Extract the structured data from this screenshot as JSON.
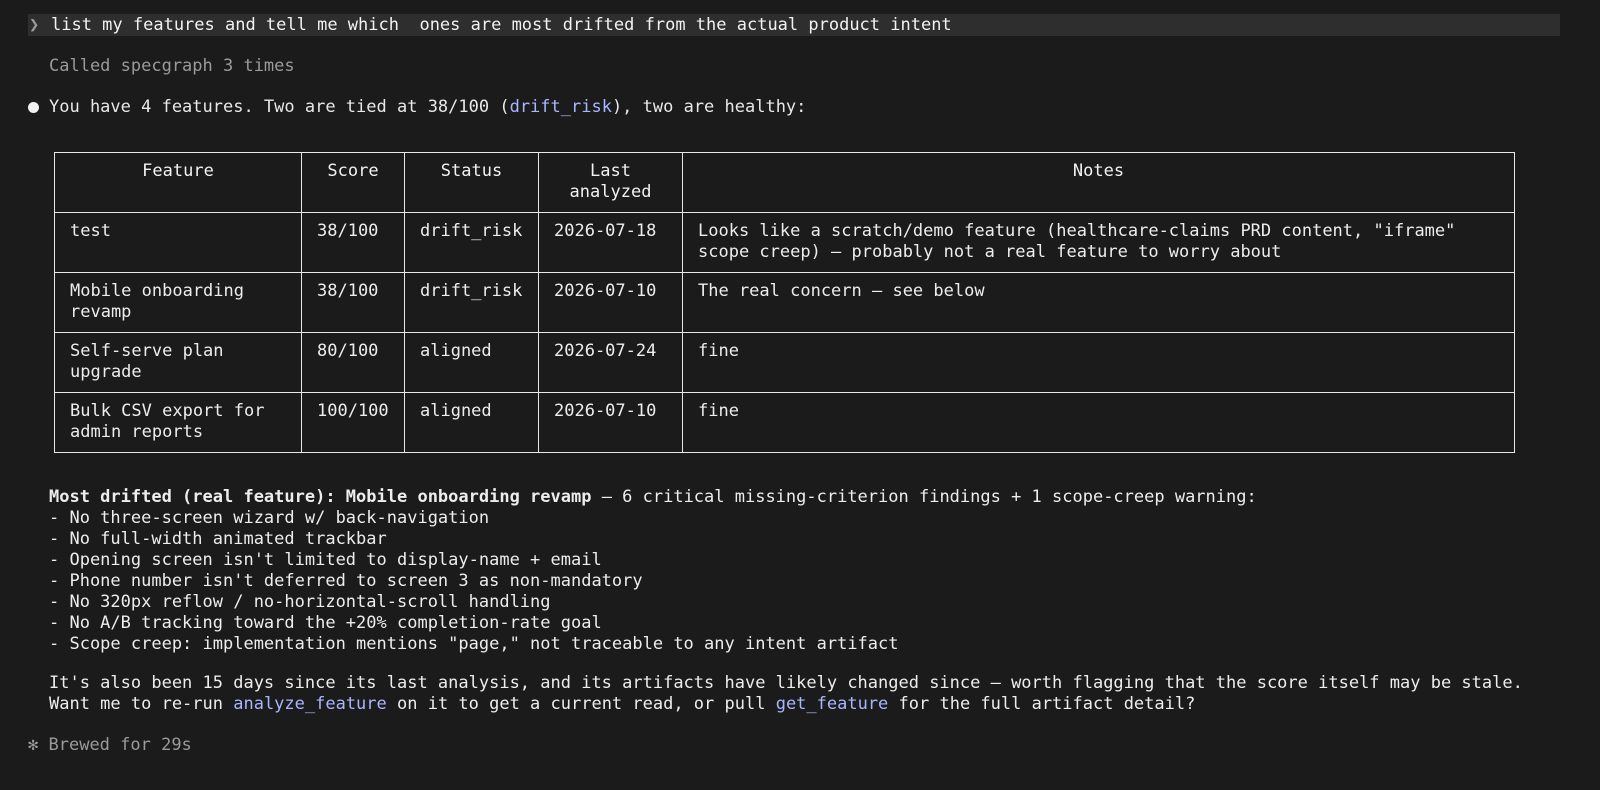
{
  "prompt": {
    "chevron": "❯",
    "text": "list my features and tell me which  ones are most drifted from the actual product intent"
  },
  "tool_call": {
    "text": "Called specgraph 3 times"
  },
  "intro": {
    "before": "You have 4 features. Two are tied at 38/100 (",
    "code": "drift_risk",
    "after": "), two are healthy:"
  },
  "table": {
    "headers": [
      "Feature",
      "Score",
      "Status",
      "Last analyzed",
      "Notes"
    ],
    "rows": [
      {
        "feature": "test",
        "feature_bold": true,
        "score": "38/100",
        "status": "drift_risk",
        "last_analyzed": "2026-07-18",
        "notes": "Looks like a scratch/demo feature (healthcare-claims PRD content, \"iframe\" scope creep) — probably not a real feature to worry about"
      },
      {
        "feature": "Mobile onboarding revamp",
        "feature_bold": true,
        "score": "38/100",
        "status": "drift_risk",
        "last_analyzed": "2026-07-10",
        "notes": "The real concern — see below"
      },
      {
        "feature": "Self-serve plan upgrade",
        "feature_bold": false,
        "score": "80/100",
        "status": "aligned",
        "last_analyzed": "2026-07-24",
        "notes": "fine"
      },
      {
        "feature": "Bulk CSV export for admin reports",
        "feature_bold": false,
        "score": "100/100",
        "status": "aligned",
        "last_analyzed": "2026-07-10",
        "notes": "fine"
      }
    ]
  },
  "summary": {
    "heading_bold": "Most drifted (real feature): Mobile onboarding revamp",
    "heading_rest": " — 6 critical missing-criterion findings + 1 scope-creep warning:",
    "items": [
      "- No three-screen wizard w/ back-navigation",
      "- No full-width animated trackbar",
      "- Opening screen isn't limited to display-name + email",
      "- Phone number isn't deferred to screen 3 as non-mandatory",
      "- No 320px reflow / no-horizontal-scroll handling",
      "- No A/B tracking toward the +20% completion-rate goal",
      "- Scope creep: implementation mentions \"page,\" not traceable to any intent artifact"
    ]
  },
  "followup": {
    "line1": "It's also been 15 days since its last analysis, and its artifacts have likely changed since — worth flagging that the score itself may be stale.",
    "line2_a": "Want me to re-run ",
    "line2_code1": "analyze_feature",
    "line2_b": " on it to get a current read, or pull ",
    "line2_code2": "get_feature",
    "line2_c": " for the full artifact detail?"
  },
  "footer": {
    "icon": "✻",
    "text": "Brewed for 29s"
  },
  "colors": {
    "background": "#1b1b1b",
    "prompt_bar": "#2e2e2e",
    "code_accent": "#a9b6ff",
    "muted": "#9a9a9a"
  }
}
